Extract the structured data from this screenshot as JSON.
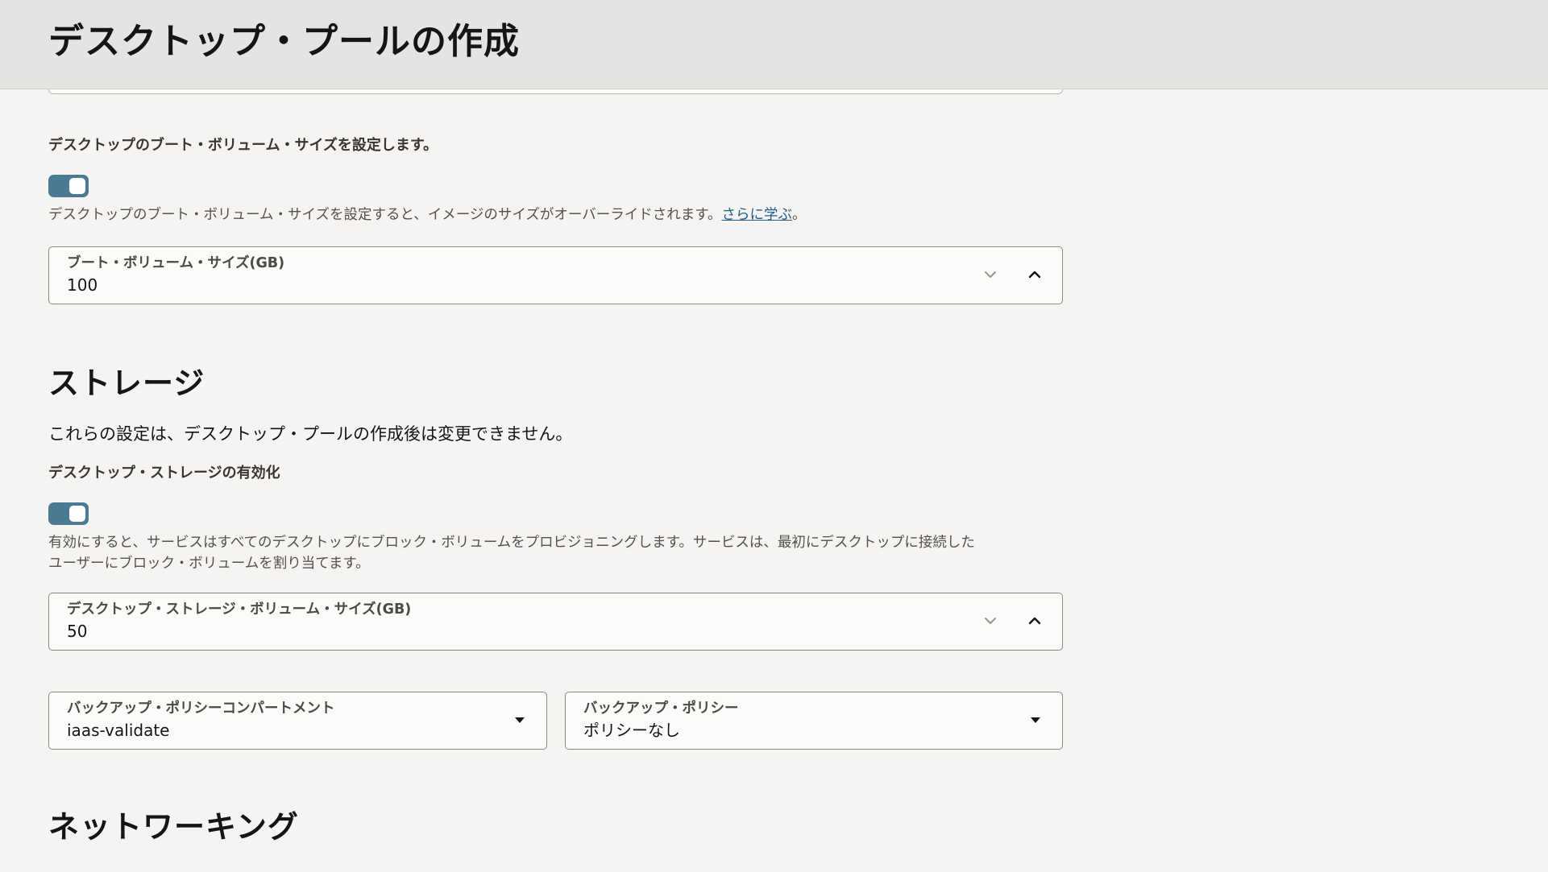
{
  "header": {
    "title": "デスクトップ・プールの作成"
  },
  "boot_volume": {
    "toggle_label": "デスクトップのブート・ボリューム・サイズを設定します。",
    "toggle_on": true,
    "help_text": "デスクトップのブート・ボリューム・サイズを設定すると、イメージのサイズがオーバーライドされます。",
    "help_link": "さらに学ぶ",
    "help_suffix": "。",
    "size_field": {
      "label": "ブート・ボリューム・サイズ(GB)",
      "value": "100"
    }
  },
  "storage": {
    "title": "ストレージ",
    "description": "これらの設定は、デスクトップ・プールの作成後は変更できません。",
    "toggle_label": "デスクトップ・ストレージの有効化",
    "toggle_on": true,
    "help_line1": "有効にすると、サービスはすべてのデスクトップにブロック・ボリュームをプロビジョニングします。サービスは、最初にデスクトップに接続した",
    "help_line2": "ユーザーにブロック・ボリュームを割り当てます。",
    "size_field": {
      "label": "デスクトップ・ストレージ・ボリューム・サイズ(GB)",
      "value": "50"
    },
    "backup_compartment": {
      "label": "バックアップ・ポリシーコンパートメント",
      "value": "iaas-validate"
    },
    "backup_policy": {
      "label": "バックアップ・ポリシー",
      "value": "ポリシーなし"
    }
  },
  "networking": {
    "title": "ネットワーキング"
  },
  "icons": {
    "spin_down": "chevron-down-icon",
    "spin_up": "chevron-up-icon",
    "dropdown": "caret-down-icon"
  },
  "colors": {
    "toggle_on": "#4b7a93",
    "link": "#1f5c8a",
    "header_bg": "#e5e4e2",
    "page_bg": "#f5f4f2"
  }
}
